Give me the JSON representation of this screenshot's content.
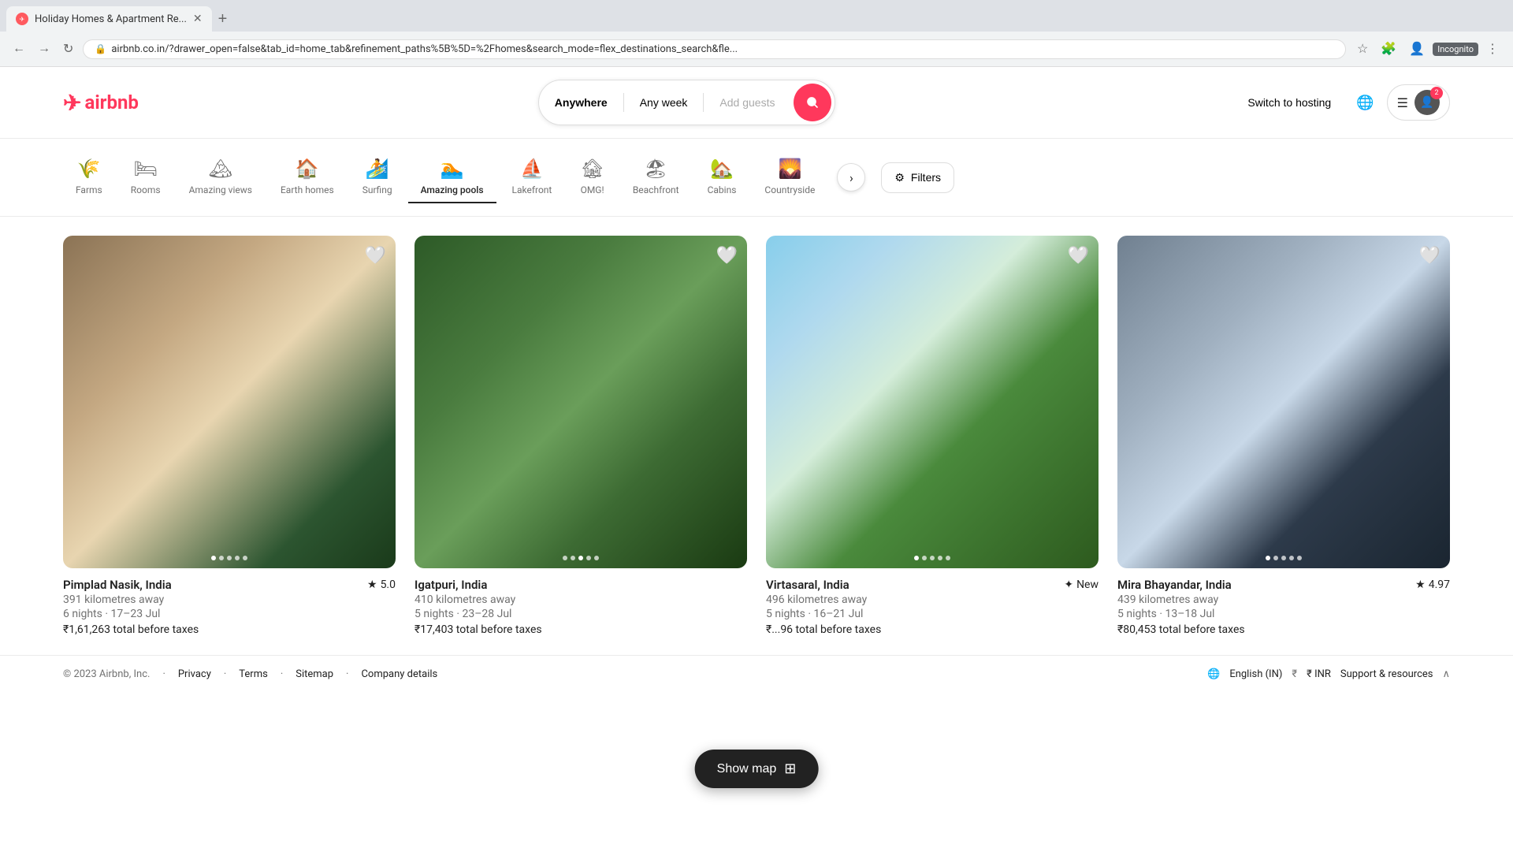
{
  "browser": {
    "tab_title": "Holiday Homes & Apartment Re...",
    "url": "airbnb.co.in/?drawer_open=false&tab_id=home_tab&refinement_paths%5B%5D=%2Fhomes&search_mode=flex_destinations_search&fle...",
    "incognito_label": "Incognito",
    "notification_count": "2"
  },
  "header": {
    "logo_text": "airbnb",
    "search": {
      "location_label": "Anywhere",
      "date_label": "Any week",
      "guests_placeholder": "Add guests"
    },
    "switch_hosting_label": "Switch to hosting",
    "language_icon": "🌐"
  },
  "categories": [
    {
      "id": "farms",
      "label": "Farms",
      "icon": "🌾"
    },
    {
      "id": "rooms",
      "label": "Rooms",
      "icon": "🛏"
    },
    {
      "id": "amazing-views",
      "label": "Amazing views",
      "icon": "🏔"
    },
    {
      "id": "earth-homes",
      "label": "Earth homes",
      "icon": "🏠"
    },
    {
      "id": "surfing",
      "label": "Surfing",
      "icon": "🏄"
    },
    {
      "id": "amazing-pools",
      "label": "Amazing pools",
      "icon": "🏊",
      "active": true
    },
    {
      "id": "lakefront",
      "label": "Lakefront",
      "icon": "⛵"
    },
    {
      "id": "omg",
      "label": "OMG!",
      "icon": "🏚"
    },
    {
      "id": "beachfront",
      "label": "Beachfront",
      "icon": "🏖"
    },
    {
      "id": "cabins",
      "label": "Cabins",
      "icon": "🏡"
    },
    {
      "id": "countryside",
      "label": "Countryside",
      "icon": "🌄"
    }
  ],
  "filters_label": "Filters",
  "listings": [
    {
      "id": 1,
      "location": "Pimplad Nasik, India",
      "rating": "5.0",
      "distance": "391 kilometres away",
      "dates": "6 nights · 17–23 Jul",
      "price": "₹1,61,263 total before taxes",
      "img_class": "img1",
      "dots": 5,
      "active_dot": 0
    },
    {
      "id": 2,
      "location": "Igatpuri, India",
      "rating": null,
      "distance": "410 kilometres away",
      "dates": "5 nights · 23–28 Jul",
      "price": "₹17,403 total before taxes",
      "img_class": "img2",
      "dots": 5,
      "active_dot": 1
    },
    {
      "id": 3,
      "location": "Virtasaral, India",
      "rating": "New",
      "distance": "496 kilometres away",
      "dates": "5 nights · 16–21 Jul",
      "price": "₹...96 total before taxes",
      "img_class": "img3",
      "dots": 5,
      "active_dot": 0
    },
    {
      "id": 4,
      "location": "Mira Bhayandar, India",
      "rating": "4.97",
      "distance": "439 kilometres away",
      "dates": "5 nights · 13–18 Jul",
      "price": "₹80,453 total before taxes",
      "img_class": "img4",
      "dots": 5,
      "active_dot": 0
    }
  ],
  "show_map_label": "Show map",
  "footer": {
    "copyright": "© 2023 Airbnb, Inc.",
    "links": [
      "Privacy",
      "Terms",
      "Sitemap",
      "Company details"
    ],
    "language": "English (IN)",
    "currency": "₹  INR",
    "support": "Support & resources"
  }
}
